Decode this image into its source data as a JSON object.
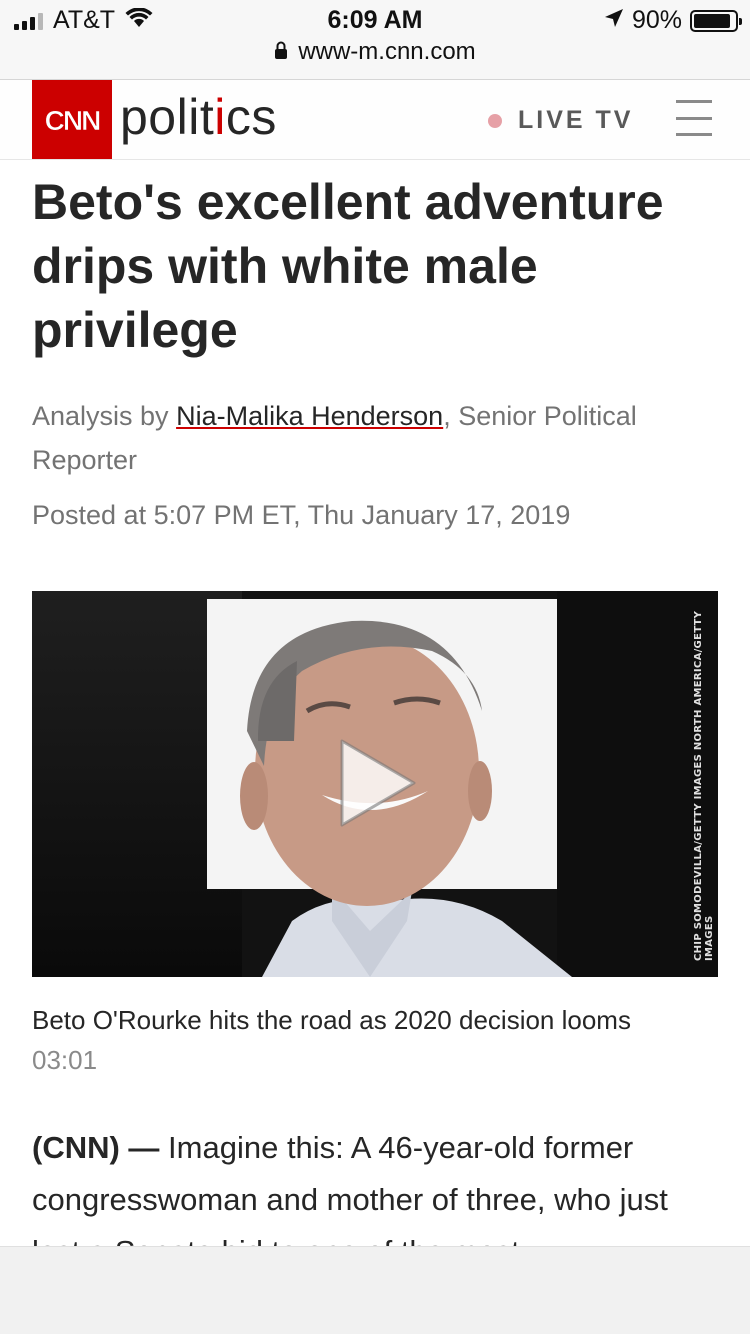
{
  "status_bar": {
    "carrier": "AT&T",
    "time": "6:09 AM",
    "battery": "90%",
    "battery_level": 0.9,
    "url": "www-m.cnn.com"
  },
  "header": {
    "logo": "CNN",
    "section": "politics",
    "live_tv": "LIVE TV",
    "brand_color": "#cc0000"
  },
  "article": {
    "headline": "Beto's excellent adventure drips with white male privilege",
    "byline_prefix": "Analysis by",
    "author": "Nia-Malika Henderson",
    "byline_suffix": ", Senior Political Reporter",
    "timestamp": "Posted at 5:07 PM ET, Thu January 17, 2019",
    "video": {
      "credit": "CHIP SOMODEVILLA/GETTY IMAGES NORTH AMERICA/GETTY IMAGES",
      "caption": "Beto O'Rourke hits the road as 2020 decision looms",
      "duration": "03:01"
    },
    "body_source": "(CNN) —",
    "body_text": "Imagine this: A 46-year-old former congresswoman and mother of three, who just lost a Senate bid to one of the most"
  }
}
